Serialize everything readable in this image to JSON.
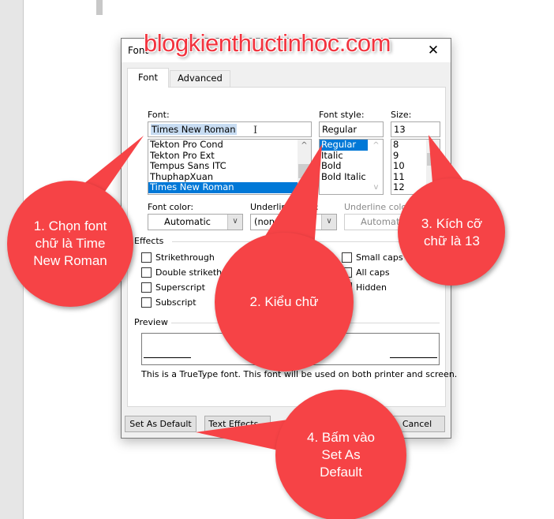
{
  "watermark": "blogkienthuctinhoc.com",
  "dialog": {
    "title": "Font",
    "close_glyph": "✕",
    "tabs": [
      {
        "label": "Font",
        "active": true
      },
      {
        "label": "Advanced",
        "active": false
      }
    ],
    "font": {
      "label": "Font:",
      "value": "Times New Roman",
      "options": [
        "Tekton Pro Cond",
        "Tekton Pro Ext",
        "Tempus Sans ITC",
        "ThuphapXuan",
        "Times New Roman"
      ],
      "selected": "Times New Roman"
    },
    "font_style": {
      "label": "Font style:",
      "value": "Regular",
      "options": [
        "Regular",
        "Italic",
        "Bold",
        "Bold Italic"
      ],
      "selected": "Regular"
    },
    "size": {
      "label": "Size:",
      "value": "13",
      "options": [
        "8",
        "9",
        "10",
        "11",
        "12"
      ]
    },
    "font_color": {
      "label": "Font color:",
      "value": "Automatic"
    },
    "underline_style": {
      "label": "Underline style:",
      "value": "(none)"
    },
    "underline_color": {
      "label": "Underline color:",
      "value": "Automatic",
      "disabled": true
    },
    "effects": {
      "label": "Effects",
      "left": [
        "Strikethrough",
        "Double strikethrough",
        "Superscript",
        "Subscript"
      ],
      "right": [
        "Small caps",
        "All caps",
        "Hidden"
      ]
    },
    "preview": {
      "label": "Preview",
      "note": "This is a TrueType font. This font will be used on both printer and screen."
    },
    "buttons": {
      "set_default": "Set As Default",
      "text_effects": "Text Effects...",
      "cancel": "Cancel"
    }
  },
  "callouts": [
    {
      "step": 1,
      "text": "1. Chọn font\nchữ là Time\nNew Roman"
    },
    {
      "step": 2,
      "text": "2. Kiểu chữ"
    },
    {
      "step": 3,
      "text": "3. Kích cỡ\nchữ là 13"
    },
    {
      "step": 4,
      "text": "4. Bấm vào\nSet As\nDefault"
    }
  ],
  "colors": {
    "callout": "#f64346",
    "selection": "#0078d7",
    "watermark": "#f2333e"
  }
}
